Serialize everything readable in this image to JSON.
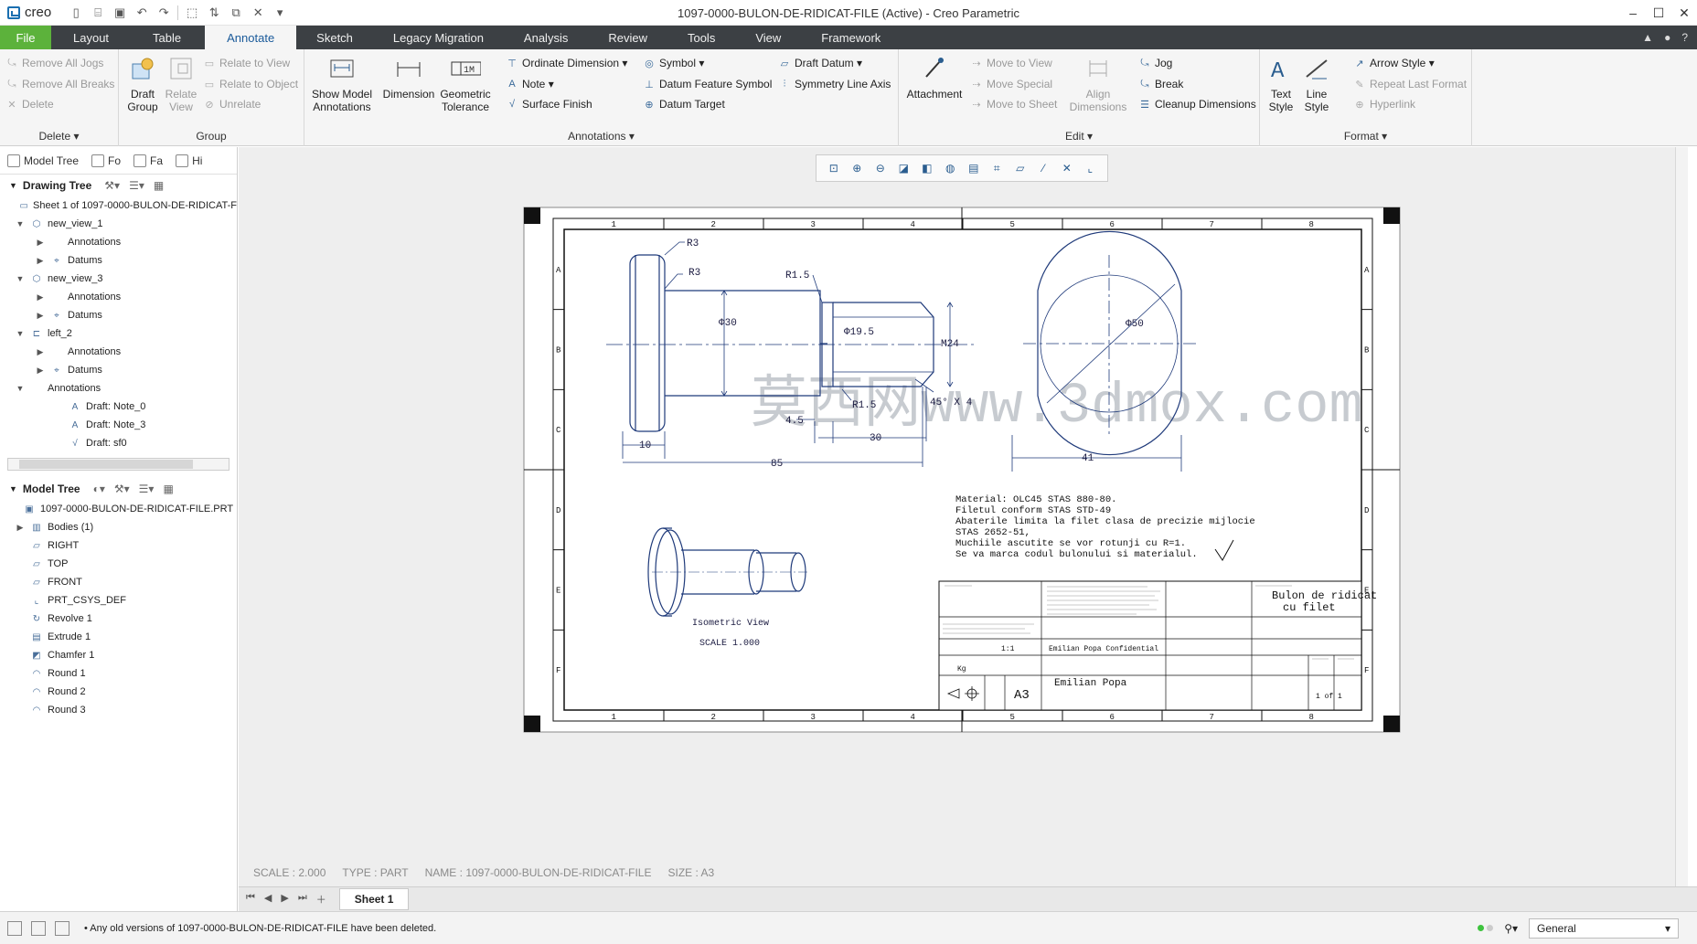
{
  "app": {
    "logo": "creo",
    "window_title": "1097-0000-BULON-DE-RIDICAT-FILE (Active) - Creo Parametric"
  },
  "ribbon_tabs": [
    {
      "label": "File"
    },
    {
      "label": "Layout"
    },
    {
      "label": "Table"
    },
    {
      "label": "Annotate"
    },
    {
      "label": "Sketch"
    },
    {
      "label": "Legacy Migration"
    },
    {
      "label": "Analysis"
    },
    {
      "label": "Review"
    },
    {
      "label": "Tools"
    },
    {
      "label": "View"
    },
    {
      "label": "Framework"
    }
  ],
  "ribbon": {
    "delete": {
      "title": "Delete",
      "remove_jogs": "Remove All Jogs",
      "remove_breaks": "Remove All Breaks",
      "delete": "Delete"
    },
    "group": {
      "title": "Group",
      "draft_group": "Draft Group",
      "relate_view": "Relate View",
      "relate_to_view": "Relate to View",
      "relate_to_object": "Relate to Object",
      "unrelate": "Unrelate"
    },
    "annotations": {
      "title": "Annotations",
      "show_model_annotations": "Show Model Annotations",
      "dimension": "Dimension",
      "geometric_tolerance": "Geometric Tolerance",
      "ordinate_dimension": "Ordinate Dimension",
      "note": "Note",
      "surface_finish": "Surface Finish",
      "symbol": "Symbol",
      "datum_feature_symbol": "Datum Feature Symbol",
      "datum_target": "Datum Target",
      "draft_datum": "Draft Datum",
      "symmetry_line_axis": "Symmetry Line Axis"
    },
    "edit": {
      "title": "Edit",
      "attachment": "Attachment",
      "move_to_view": "Move to View",
      "move_special": "Move Special",
      "move_to_sheet": "Move to Sheet",
      "align_dimensions": "Align Dimensions",
      "jog": "Jog",
      "break": "Break",
      "cleanup_dimensions": "Cleanup Dimensions"
    },
    "format": {
      "title": "Format",
      "text_style": "Text Style",
      "line_style": "Line Style",
      "arrow_style": "Arrow Style",
      "repeat_last_format": "Repeat Last Format",
      "hyperlink": "Hyperlink"
    }
  },
  "left_panel": {
    "tabs": [
      "Model Tree",
      "Fo",
      "Fa",
      "Hi"
    ],
    "drawing_tree": {
      "title": "Drawing Tree",
      "items": [
        {
          "label": "Sheet 1 of 1097-0000-BULON-DE-RIDICAT-F",
          "toggle": "",
          "icon": "▭"
        },
        {
          "label": "new_view_1",
          "toggle": "▼",
          "icon": "⬡"
        },
        {
          "label": "Annotations",
          "toggle": "▶",
          "icon": ""
        },
        {
          "label": "Datums",
          "toggle": "▶",
          "icon": "⌖"
        },
        {
          "label": "new_view_3",
          "toggle": "▼",
          "icon": "⬡"
        },
        {
          "label": "Annotations",
          "toggle": "▶",
          "icon": ""
        },
        {
          "label": "Datums",
          "toggle": "▶",
          "icon": "⌖"
        },
        {
          "label": "left_2",
          "toggle": "▼",
          "icon": "⊏"
        },
        {
          "label": "Annotations",
          "toggle": "▶",
          "icon": ""
        },
        {
          "label": "Datums",
          "toggle": "▶",
          "icon": "⌖"
        },
        {
          "label": "Annotations",
          "toggle": "▼",
          "icon": ""
        },
        {
          "label": "Draft: Note_0",
          "toggle": "",
          "icon": "A"
        },
        {
          "label": "Draft: Note_3",
          "toggle": "",
          "icon": "A"
        },
        {
          "label": "Draft: sf0",
          "toggle": "",
          "icon": "√"
        }
      ]
    },
    "model_tree": {
      "title": "Model Tree",
      "items": [
        {
          "label": "1097-0000-BULON-DE-RIDICAT-FILE.PRT",
          "toggle": "",
          "icon": "▣"
        },
        {
          "label": "Bodies (1)",
          "toggle": "▶",
          "icon": "▥"
        },
        {
          "label": "RIGHT",
          "toggle": "",
          "icon": "▱"
        },
        {
          "label": "TOP",
          "toggle": "",
          "icon": "▱"
        },
        {
          "label": "FRONT",
          "toggle": "",
          "icon": "▱"
        },
        {
          "label": "PRT_CSYS_DEF",
          "toggle": "",
          "icon": "⌞"
        },
        {
          "label": "Revolve 1",
          "toggle": "",
          "icon": "↻"
        },
        {
          "label": "Extrude 1",
          "toggle": "",
          "icon": "▤"
        },
        {
          "label": "Chamfer 1",
          "toggle": "",
          "icon": "◩"
        },
        {
          "label": "Round 1",
          "toggle": "",
          "icon": "◠"
        },
        {
          "label": "Round 2",
          "toggle": "",
          "icon": "◠"
        },
        {
          "label": "Round 3",
          "toggle": "",
          "icon": "◠"
        }
      ]
    }
  },
  "drawing": {
    "zone_cols": [
      "1",
      "2",
      "3",
      "4",
      "5",
      "6",
      "7",
      "8"
    ],
    "zone_rows": [
      "A",
      "B",
      "C",
      "D",
      "E",
      "F"
    ],
    "dims": {
      "r3_a": "R3",
      "r3_b": "R3",
      "r1_5_a": "R1.5",
      "r1_5_b": "R1.5",
      "d30": "Φ30",
      "d19_5": "Φ19.5",
      "m24": "M24",
      "chamfer": "45° X 4",
      "len_4_5": "4.5",
      "len_10": "10",
      "len_30": "30",
      "len_85": "85",
      "d50": "Φ50",
      "len_41": "41"
    },
    "isometric_label": "Isometric View",
    "isometric_scale": "SCALE 1.000",
    "notes": [
      "Material: OLC45 STAS 880-80.",
      "Filetul conform STAS STD-49",
      "Abaterile limita la filet clasa de precizie mijlocie",
      "STAS 2652-51,",
      "Muchiile ascutite se vor rotunji cu R=1.",
      "Se va marca codul bulonului si materialul."
    ],
    "title_block": {
      "title_line1": "Bulon de ridicat",
      "title_line2": "cu filet",
      "size": "A3",
      "author": "Emilian Popa",
      "scale": "1:1",
      "sheet": "1 of 1",
      "weight_unit": "Kg",
      "confidential": "Emilian Popa Confidential"
    },
    "watermark": "莫西网www.3dmox.com"
  },
  "graphics_status": {
    "scale": "SCALE : 2.000",
    "type": "TYPE : PART",
    "name": "NAME : 1097-0000-BULON-DE-RIDICAT-FILE",
    "size": "SIZE : A3"
  },
  "sheet_tab": "Sheet 1",
  "status": {
    "message": "• Any old versions of 1097-0000-BULON-DE-RIDICAT-FILE have been deleted.",
    "filter": "General"
  },
  "colors": {
    "accent_green": "#5cb23b",
    "tab_bar": "#3c4044",
    "drawing_line": "#1f3a7a",
    "sheet_border": "#111111"
  }
}
